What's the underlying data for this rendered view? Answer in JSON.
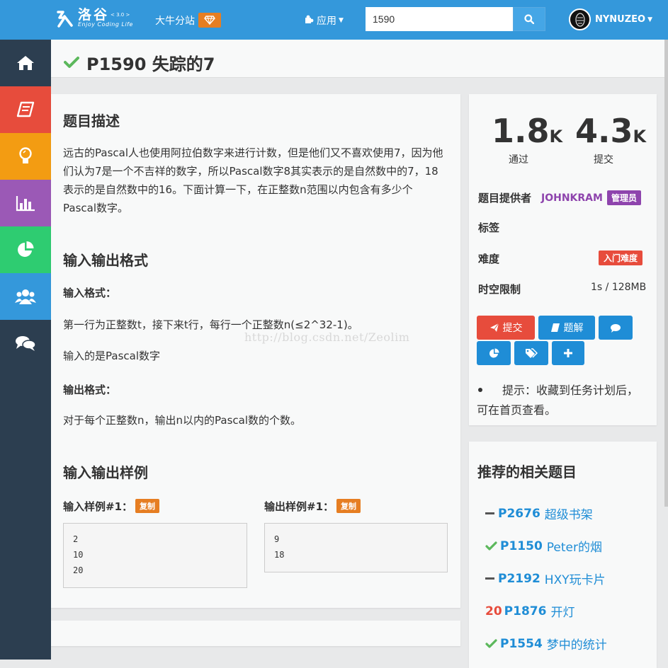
{
  "brand": {
    "logo_cn": "洛谷",
    "version": "< 3.0 >",
    "subtitle": "Enjoy Coding Life",
    "logo_small": "Luogu"
  },
  "nav": {
    "site_link": "大牛分站",
    "apps": "应用"
  },
  "search": {
    "value": "1590"
  },
  "user": {
    "name": "NYNUZEO"
  },
  "problem": {
    "title": "P1590 失踪的7",
    "desc_heading": "题目描述",
    "description": "远古的Pascal人也使用阿拉伯数字来进行计数，但是他们又不喜欢使用7，因为他们认为7是一个不吉祥的数字，所以Pascal数字8其实表示的是自然数中的7，18表示的是自然数中的16。下面计算一下，在正整数n范围以内包含有多少个Pascal数字。",
    "io_heading": "输入输出格式",
    "input_label": "输入格式：",
    "input_text": "第一行为正整数t，接下来t行，每行一个正整数n(≤2^32-1)。",
    "input_text2": "输入的是Pascal数字",
    "output_label": "输出格式：",
    "output_text": "对于每个正整数n，输出n以内的Pascal数的个数。",
    "sample_heading": "输入输出样例",
    "sample_in_label": "输入样例#1：",
    "sample_out_label": "输出样例#1：",
    "copy_label": "复制",
    "sample_in": "2\n10\n20",
    "sample_out": "9\n18"
  },
  "stats": {
    "accepted_num": "1.8",
    "accepted_unit": "K",
    "accepted_label": "通过",
    "submit_num": "4.3",
    "submit_unit": "K",
    "submit_label": "提交",
    "provider_label": "题目提供者",
    "provider_name": "JOHNKRAM",
    "provider_role": "管理员",
    "tags_label": "标签",
    "difficulty_label": "难度",
    "difficulty_value": "入门难度",
    "limit_label": "时空限制",
    "limit_value": "1s / 128MB"
  },
  "actions": {
    "submit": "提交",
    "solutions": "题解"
  },
  "tip": "提示：收藏到任务计划后，可在首页查看。",
  "recommend": {
    "title": "推荐的相关题目",
    "items": [
      {
        "status": "none",
        "id": "P2676",
        "name": "超级书架"
      },
      {
        "status": "ac",
        "id": "P1150",
        "name": "Peter的烟"
      },
      {
        "status": "none",
        "id": "P2192",
        "name": "HXY玩卡片"
      },
      {
        "status": "score",
        "score": "20",
        "id": "P1876",
        "name": "开灯"
      },
      {
        "status": "ac",
        "id": "P1554",
        "name": "梦中的统计"
      }
    ]
  },
  "watermark": "http://blog.csdn.net/Zeolim",
  "colors": {
    "primary": "#3498db",
    "danger": "#e74c3c",
    "success": "#5cb85c",
    "purple": "#8e44ad",
    "orange": "#e67e22"
  }
}
